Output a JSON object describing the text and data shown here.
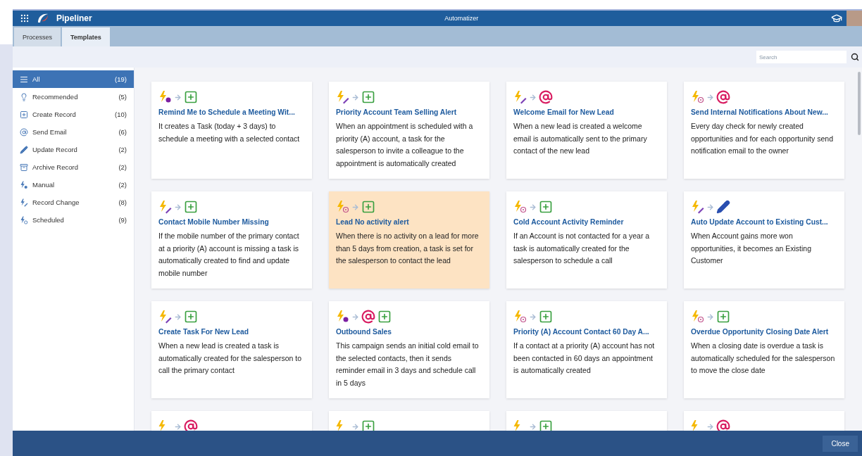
{
  "header": {
    "app_name": "Pipeliner",
    "title": "Automatizer"
  },
  "tabs": [
    {
      "label": "Processes",
      "selected": false
    },
    {
      "label": "Templates",
      "selected": true
    }
  ],
  "search": {
    "placeholder": "Search"
  },
  "sidebar": {
    "items": [
      {
        "kind": "all",
        "label": "All",
        "count": "(19)",
        "selected": true
      },
      {
        "kind": "recommended",
        "label": "Recommended",
        "count": "(5)",
        "selected": false
      },
      {
        "kind": "create",
        "label": "Create Record",
        "count": "(10)",
        "selected": false
      },
      {
        "kind": "email",
        "label": "Send Email",
        "count": "(6)",
        "selected": false
      },
      {
        "kind": "update",
        "label": "Update Record",
        "count": "(2)",
        "selected": false
      },
      {
        "kind": "archive",
        "label": "Archive Record",
        "count": "(2)",
        "selected": false
      },
      {
        "kind": "manual",
        "label": "Manual",
        "count": "(2)",
        "selected": false
      },
      {
        "kind": "record-change",
        "label": "Record Change",
        "count": "(8)",
        "selected": false
      },
      {
        "kind": "scheduled",
        "label": "Scheduled",
        "count": "(9)",
        "selected": false
      }
    ]
  },
  "cards": [
    {
      "trigger": {
        "kind": "manual"
      },
      "actions": [
        {
          "kind": "create"
        }
      ],
      "title": "Remind Me to Schedule a Meeting Wit...",
      "description": "It creates a Task (today + 3 days) to schedule a meeting with a selected contact",
      "selected": false
    },
    {
      "trigger": {
        "kind": "record-change"
      },
      "actions": [
        {
          "kind": "create"
        }
      ],
      "title": "Priority Account Team Selling Alert",
      "description": "When an appointment is scheduled with a priority (A) account, a task for the salesperson to invite a colleague to the appointment is automatically created",
      "selected": false
    },
    {
      "trigger": {
        "kind": "record-change"
      },
      "actions": [
        {
          "kind": "email"
        }
      ],
      "title": "Welcome Email for New Lead",
      "description": "When a new lead is created a welcome email is automatically sent to the primary contact of the new lead",
      "selected": false
    },
    {
      "trigger": {
        "kind": "scheduled"
      },
      "actions": [
        {
          "kind": "email"
        }
      ],
      "title": "Send Internal Notifications About New...",
      "description": "Every day check for newly created opportunities and for each opportunity send notification email to the owner",
      "selected": false
    },
    {
      "trigger": {
        "kind": "record-change"
      },
      "actions": [
        {
          "kind": "create"
        }
      ],
      "title": "Contact Mobile Number Missing",
      "description": "If the mobile number of the primary contact at a priority (A) account is missing a task is automatically created to find and update mobile number",
      "selected": false
    },
    {
      "trigger": {
        "kind": "scheduled"
      },
      "actions": [
        {
          "kind": "create"
        }
      ],
      "title": "Lead No activity alert",
      "description": "When there is no activity on a lead for more than 5 days from creation, a task is set for the salesperson to contact the lead",
      "selected": true
    },
    {
      "trigger": {
        "kind": "scheduled"
      },
      "actions": [
        {
          "kind": "create"
        }
      ],
      "title": "Cold Account Activity Reminder",
      "description": "If an Account is not contacted for a year a task is automatically created for the salesperson to schedule a call",
      "selected": false
    },
    {
      "trigger": {
        "kind": "record-change"
      },
      "actions": [
        {
          "kind": "update"
        }
      ],
      "title": "Auto Update Account to Existing Cust...",
      "description": "When Account gains more won opportunities, it becomes an Existing Customer",
      "selected": false
    },
    {
      "trigger": {
        "kind": "record-change"
      },
      "actions": [
        {
          "kind": "create"
        }
      ],
      "title": "Create Task For New Lead",
      "description": "When a new lead is created a task is automatically created for the salesperson to call the primary contact",
      "selected": false
    },
    {
      "trigger": {
        "kind": "manual"
      },
      "actions": [
        {
          "kind": "email"
        },
        {
          "kind": "create"
        }
      ],
      "title": "Outbound Sales",
      "description": "This campaign sends an initial cold email to the selected contacts, then it sends reminder email in 3 days and schedule call in 5 days",
      "selected": false
    },
    {
      "trigger": {
        "kind": "scheduled"
      },
      "actions": [
        {
          "kind": "create"
        }
      ],
      "title": "Priority (A) Account Contact 60 Day A...",
      "description": "If a contact at a priority (A) account has not been contacted in 60 days an appointment is automatically created",
      "selected": false
    },
    {
      "trigger": {
        "kind": "scheduled"
      },
      "actions": [
        {
          "kind": "create"
        }
      ],
      "title": "Overdue Opportunity Closing Date Alert",
      "description": "When a closing date is overdue a task is automatically scheduled for the salesperson to move the close date",
      "selected": false
    },
    {
      "trigger": {
        "kind": "lightning"
      },
      "actions": [
        {
          "kind": "email"
        }
      ],
      "selected": false
    },
    {
      "trigger": {
        "kind": "lightning"
      },
      "actions": [
        {
          "kind": "create"
        }
      ],
      "selected": false
    },
    {
      "trigger": {
        "kind": "lightning"
      },
      "actions": [
        {
          "kind": "create"
        }
      ],
      "selected": false
    },
    {
      "trigger": {
        "kind": "lightning"
      },
      "actions": [
        {
          "kind": "email"
        }
      ],
      "selected": false
    }
  ],
  "footer": {
    "close_button": "Close"
  }
}
